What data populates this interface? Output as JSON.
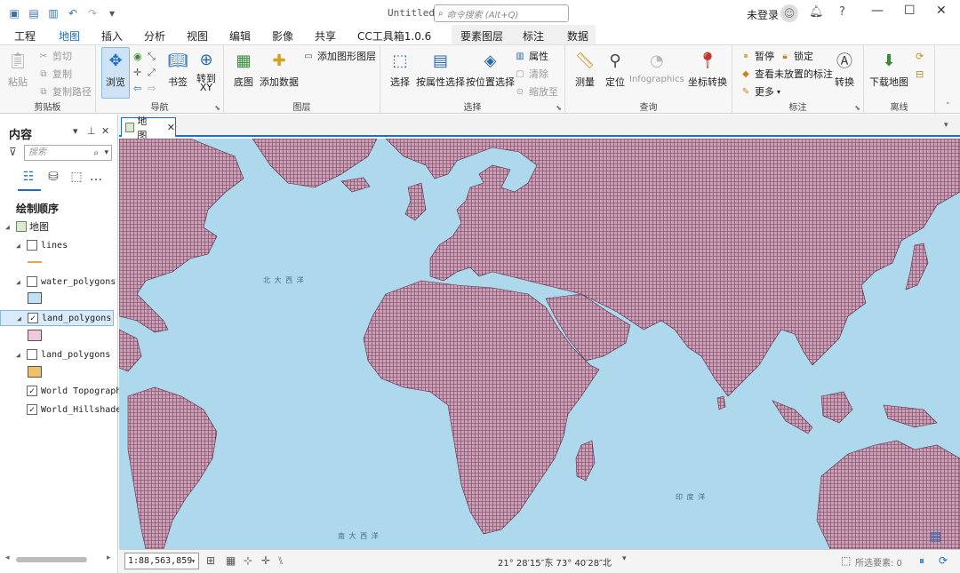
{
  "window": {
    "title": "Untitled",
    "command_search_placeholder": "命令搜索 (Alt+Q)",
    "login_label": "未登录"
  },
  "tabs": [
    "工程",
    "地图",
    "插入",
    "分析",
    "视图",
    "编辑",
    "影像",
    "共享",
    "CC工具箱1.0.6",
    "要素图层",
    "标注",
    "数据"
  ],
  "ribbon": {
    "clipboard": {
      "label": "剪贴板",
      "paste": "粘贴",
      "cut": "剪切",
      "copy": "复制",
      "copy_path": "复制路径"
    },
    "navigate": {
      "label": "导航",
      "explore": "浏览",
      "bookmarks": "书签",
      "goto_xy": "转到\nXY"
    },
    "layer": {
      "label": "图层",
      "basemap": "底图",
      "add_data": "添加数据",
      "add_graphics_layer": "添加图形图层"
    },
    "selection": {
      "label": "选择",
      "select": "选择",
      "select_by_attr": "按属性选择",
      "select_by_location": "按位置选择",
      "attributes": "属性",
      "clear": "清除",
      "zoom_to": "缩放至"
    },
    "inquiry": {
      "label": "查询",
      "measure": "测量",
      "locate": "定位",
      "infographics": "Infographics",
      "coord_convert": "坐标转换"
    },
    "labeling": {
      "label": "标注",
      "pause": "暂停",
      "lock": "锁定",
      "view_unplaced": "查看未放置的标注",
      "more": "更多",
      "convert": "转换"
    },
    "offline": {
      "label": "离线",
      "download_map": "下载地图"
    }
  },
  "contents": {
    "title": "内容",
    "search_placeholder": "搜索",
    "draw_order": "绘制顺序",
    "map_name": "地图",
    "layers": [
      {
        "name": "lines",
        "checked": false,
        "symbol": "line",
        "color": "#e2a844"
      },
      {
        "name": "water_polygons",
        "checked": false,
        "symbol": "fill",
        "color": "#bfe3f4"
      },
      {
        "name": "land_polygons",
        "checked": true,
        "symbol": "fill",
        "color": "#f0c8dc",
        "selected": true
      },
      {
        "name": "land_polygons",
        "checked": false,
        "symbol": "fill",
        "color": "#f4bf6a"
      },
      {
        "name": "World Topographic",
        "checked": true
      },
      {
        "name": "World_Hillshade",
        "checked": true
      }
    ]
  },
  "map_tab": {
    "label": "地图"
  },
  "map": {
    "labels": {
      "north_atlantic": "北 大 西 洋",
      "indian_ocean": "印 度 洋",
      "south_atlantic": "南 大 西 洋"
    },
    "colors": {
      "ocean": "#aed8ec",
      "land_hatch": "#7a3a5c",
      "land_fill": "#c5a2b4"
    }
  },
  "status": {
    "scale": "1:88,563,859",
    "coordinates": "21° 28′15″东  73° 40′28″北",
    "selected_features": "所选要素: 0"
  }
}
